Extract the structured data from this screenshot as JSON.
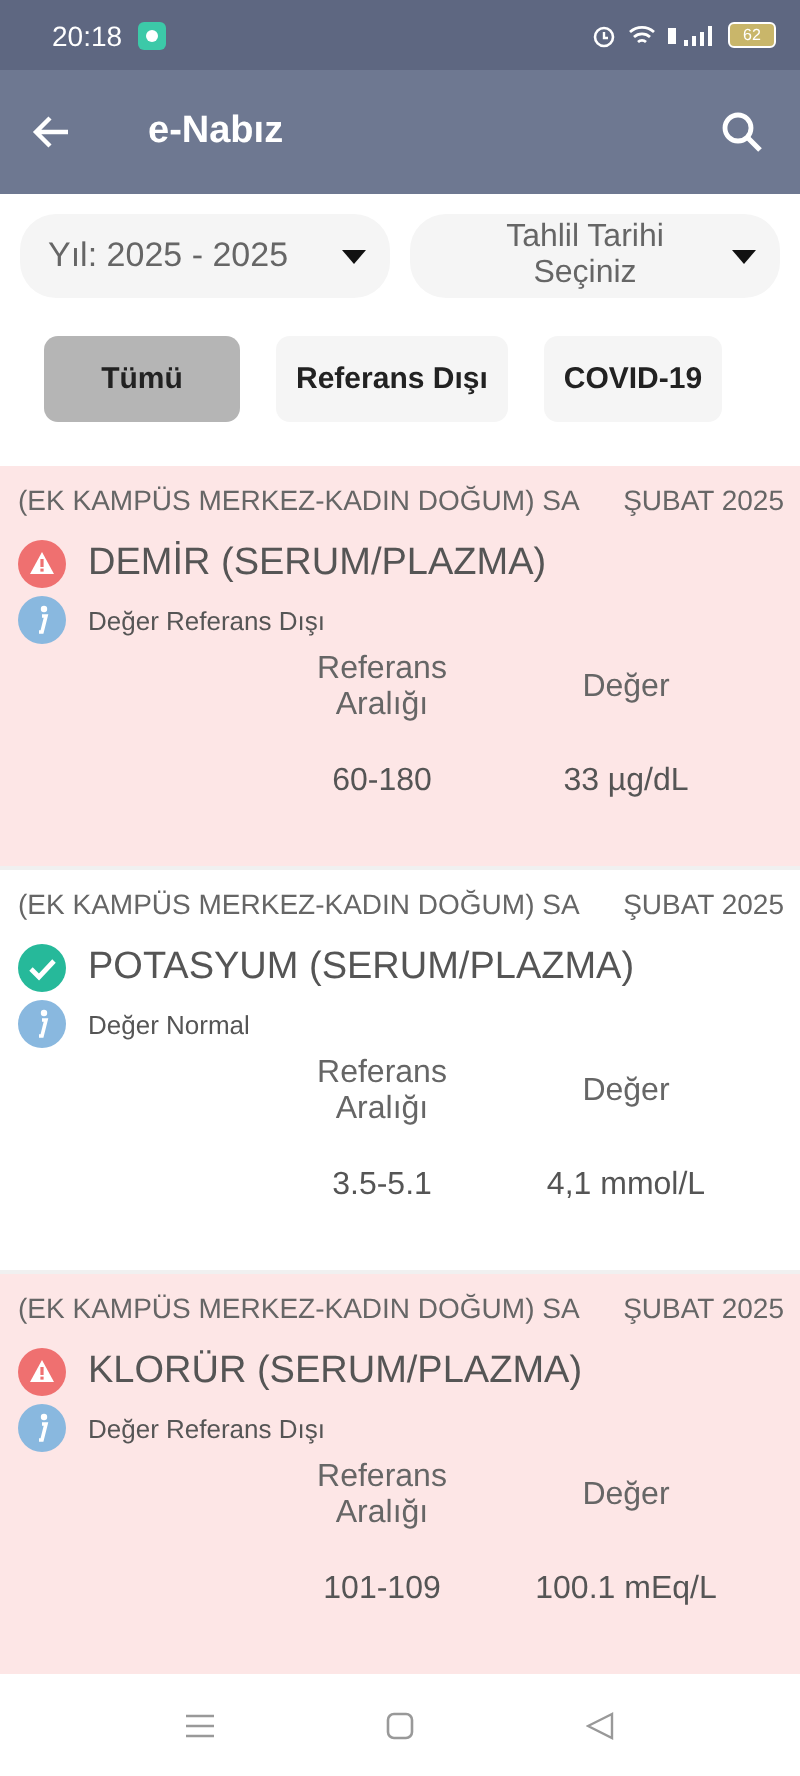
{
  "status_bar": {
    "time": "20:18",
    "battery": "62"
  },
  "app_bar": {
    "title": "e-Nabız"
  },
  "filters": [
    {
      "label": "Yıl: 2025 - 2025",
      "kind": "value"
    },
    {
      "label": "Tahlil Tarihi Seçiniz",
      "kind": "placeholder"
    }
  ],
  "tabs": [
    {
      "label": "Tümü",
      "selected": true
    },
    {
      "label": "Referans Dışı",
      "selected": false
    },
    {
      "label": "COVID-19",
      "selected": false
    }
  ],
  "results": [
    {
      "hospital": "(EK KAMPÜS MERKEZ-KADIN DOĞUM) SA",
      "date": "ŞUBAT 2025",
      "name": "DEMİR (SERUM/PLAZMA)",
      "kind": "abnormal",
      "note": "Değer Referans Dışı",
      "range_label": "Referans Aralığı",
      "value_label": "Değer",
      "range": "60-180",
      "value": "33 µg/dL"
    },
    {
      "hospital": "(EK KAMPÜS MERKEZ-KADIN DOĞUM) SA",
      "date": "ŞUBAT 2025",
      "name": "POTASYUM (SERUM/PLAZMA)",
      "kind": "normal",
      "note": "Değer Normal",
      "range_label": "Referans Aralığı",
      "value_label": "Değer",
      "range": "3.5-5.1",
      "value": "4,1 mmol/L"
    },
    {
      "hospital": "(EK KAMPÜS MERKEZ-KADIN DOĞUM) SA",
      "date": "ŞUBAT 2025",
      "name": "KLORÜR (SERUM/PLAZMA)",
      "kind": "abnormal",
      "note": "Değer Referans Dışı",
      "range_label": "Referans Aralığı",
      "value_label": "Değer",
      "range": "101-109",
      "value": "100.1 mEq/L"
    }
  ]
}
